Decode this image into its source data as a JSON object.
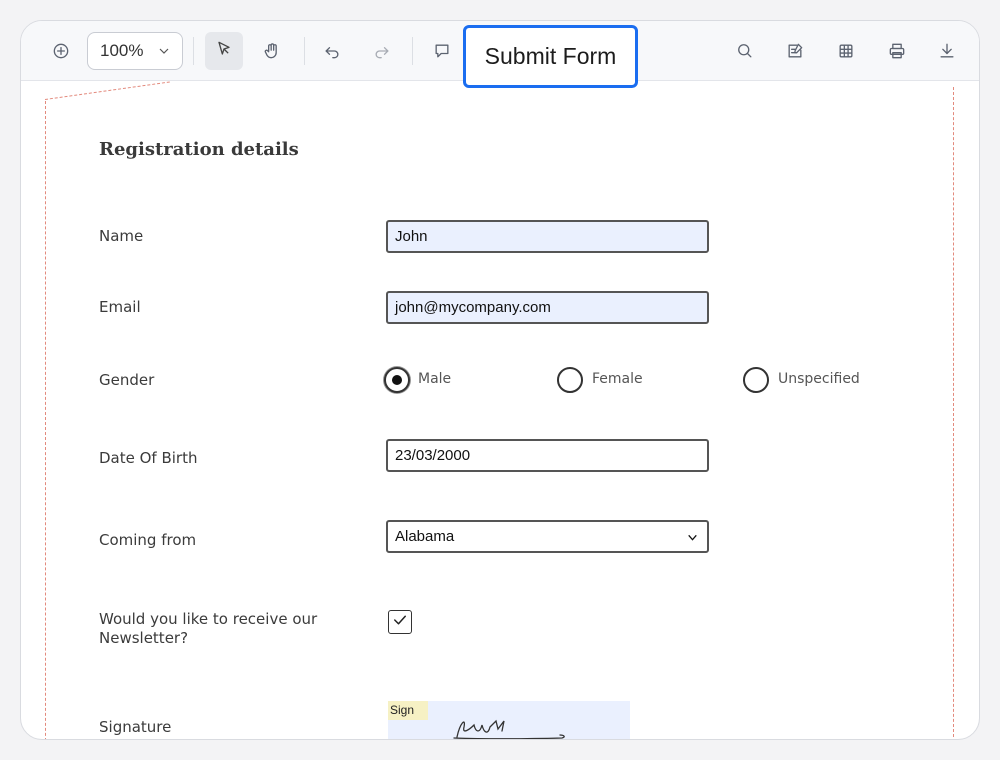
{
  "toolbar": {
    "zoom_value": "100%",
    "submit_label": "Submit Form",
    "icons": [
      "zoom-in-icon",
      "chevron-down-icon",
      "pointer-icon",
      "hand-icon",
      "undo-icon",
      "redo-icon",
      "comment-icon",
      "search-icon",
      "edit-form-icon",
      "table-icon",
      "print-icon",
      "download-icon"
    ]
  },
  "form": {
    "heading": "Registration details",
    "name": {
      "label": "Name",
      "value": "John"
    },
    "email": {
      "label": "Email",
      "value": "john@mycompany.com"
    },
    "gender": {
      "label": "Gender",
      "options": [
        "Male",
        "Female",
        "Unspecified"
      ],
      "selected": "Male"
    },
    "dob": {
      "label": "Date Of Birth",
      "value": "23/03/2000"
    },
    "coming_from": {
      "label": "Coming from",
      "value": "Alabama"
    },
    "newsletter": {
      "label": "Would you like to receive our Newsletter?",
      "checked": true
    },
    "signature": {
      "label": "Signature",
      "tag": "Sign"
    }
  },
  "colors": {
    "accent": "#1a6df0",
    "filled_field": "#eaf0fe",
    "page_border": "#e38a7d",
    "sign_tag": "#f6f1c4"
  }
}
